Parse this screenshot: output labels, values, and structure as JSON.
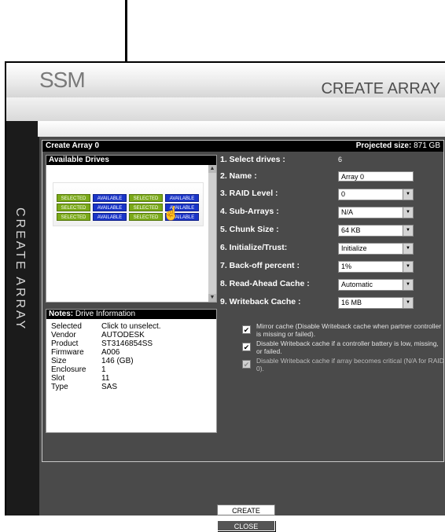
{
  "header": {
    "logo": "SSM",
    "title": "CREATE ARRAY"
  },
  "side_label": "CREATE ARRAY",
  "create_array": {
    "heading": "Create Array 0",
    "projected_label": "Projected size:",
    "projected_value": "871 GB"
  },
  "available_drives": {
    "title": "Available Drives",
    "rows": [
      [
        "SELECTED",
        "AVAILABLE",
        "SELECTED",
        "AVAILABLE"
      ],
      [
        "SELECTED",
        "AVAILABLE",
        "SELECTED",
        "AVAILABLE"
      ],
      [
        "SELECTED",
        "AVAILABLE",
        "SELECTED",
        "AVAILABLE"
      ]
    ]
  },
  "notes": {
    "label": "Notes:",
    "title": "Drive Information",
    "rows": [
      {
        "k": "Selected",
        "v": "Click to unselect."
      },
      {
        "k": "Vendor",
        "v": "AUTODESK"
      },
      {
        "k": "Product",
        "v": "ST3146854SS"
      },
      {
        "k": "Firmware",
        "v": "A006"
      },
      {
        "k": "Size",
        "v": "146 (GB)"
      },
      {
        "k": "Enclosure",
        "v": "1"
      },
      {
        "k": "Slot",
        "v": "11"
      },
      {
        "k": "Type",
        "v": "SAS"
      }
    ]
  },
  "form": {
    "select_drives": {
      "label": "1. Select drives :",
      "value": "6"
    },
    "name": {
      "label": "2. Name :",
      "value": "Array 0"
    },
    "raid_level": {
      "label": "3. RAID Level :",
      "value": "0"
    },
    "sub_arrays": {
      "label": "4. Sub-Arrays :",
      "value": "N/A"
    },
    "chunk_size": {
      "label": "5. Chunk Size :",
      "value": "64 KB"
    },
    "initialize": {
      "label": "6. Initialize/Trust:",
      "value": "Initialize"
    },
    "backoff": {
      "label": "7. Back-off percent :",
      "value": "1%"
    },
    "read_ahead": {
      "label": "8. Read-Ahead Cache :",
      "value": "Automatic"
    },
    "writeback": {
      "label": "9. Writeback Cache :",
      "value": "16 MB"
    }
  },
  "checkboxes": [
    {
      "text": "Mirror cache (Disable Writeback cache when partner controller is missing or failed).",
      "checked": true,
      "disabled": false
    },
    {
      "text": "Disable Writeback cache if a controller battery is low, missing, or failed.",
      "checked": true,
      "disabled": false
    },
    {
      "text": "Disable Writeback cache if array becomes critical (N/A for RAID 0).",
      "checked": true,
      "disabled": true
    }
  ],
  "buttons": {
    "create": "CREATE",
    "close": "CLOSE"
  },
  "colors": {
    "selected": "#7aa918",
    "available": "#1a35c8",
    "panel": "#4a4a4a"
  }
}
